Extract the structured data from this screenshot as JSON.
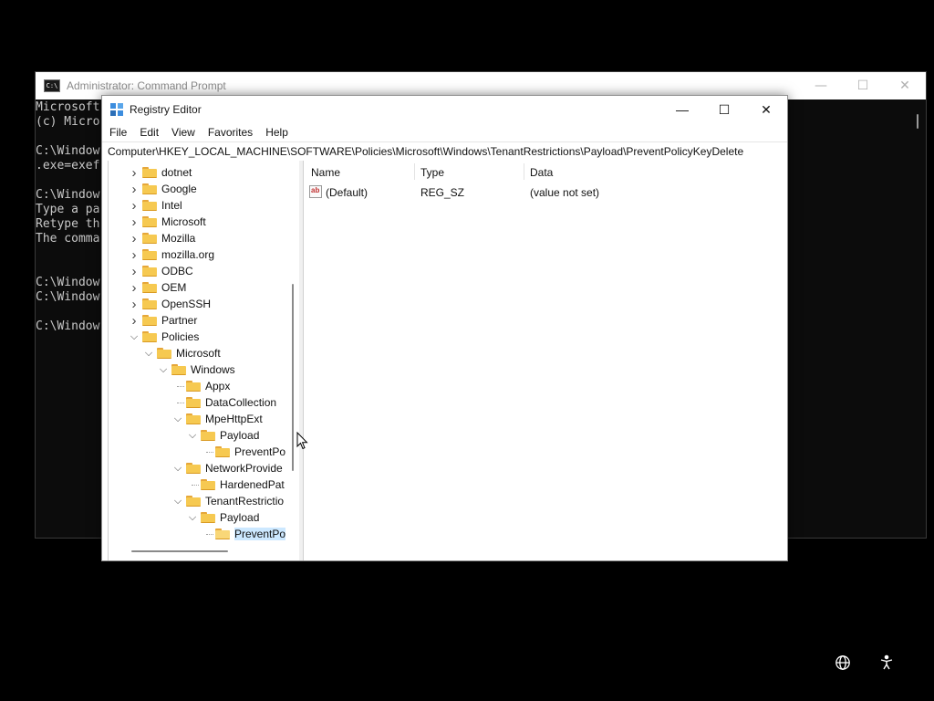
{
  "cmd": {
    "title": "Administrator: Command Prompt",
    "lines": [
      "Microsoft",
      "(c) Micro",
      "",
      "C:\\Window",
      ".exe=exef",
      "",
      "C:\\Window",
      "Type a pa",
      "Retype th",
      "The comma",
      "",
      "",
      "C:\\Window",
      "C:\\Window",
      "",
      "C:\\Window"
    ]
  },
  "regedit": {
    "title": "Registry Editor",
    "menu": [
      "File",
      "Edit",
      "View",
      "Favorites",
      "Help"
    ],
    "address": "Computer\\HKEY_LOCAL_MACHINE\\SOFTWARE\\Policies\\Microsoft\\Windows\\TenantRestrictions\\Payload\\PreventPolicyKeyDelete",
    "tree": [
      {
        "label": "dotnet",
        "state": "collapsed"
      },
      {
        "label": "Google",
        "state": "collapsed"
      },
      {
        "label": "Intel",
        "state": "collapsed"
      },
      {
        "label": "Microsoft",
        "state": "collapsed"
      },
      {
        "label": "Mozilla",
        "state": "collapsed"
      },
      {
        "label": "mozilla.org",
        "state": "collapsed"
      },
      {
        "label": "ODBC",
        "state": "collapsed"
      },
      {
        "label": "OEM",
        "state": "collapsed"
      },
      {
        "label": "OpenSSH",
        "state": "collapsed"
      },
      {
        "label": "Partner",
        "state": "collapsed"
      },
      {
        "label": "Policies",
        "state": "expanded"
      },
      {
        "label": "Microsoft",
        "state": "expanded"
      },
      {
        "label": "Windows",
        "state": "expanded"
      },
      {
        "label": "Appx",
        "state": "leaf"
      },
      {
        "label": "DataCollection",
        "state": "leaf"
      },
      {
        "label": "MpeHttpExt",
        "state": "expanded"
      },
      {
        "label": "Payload",
        "state": "expanded"
      },
      {
        "label": "PreventPo",
        "state": "leaf"
      },
      {
        "label": "NetworkProvide",
        "state": "expanded"
      },
      {
        "label": "HardenedPat",
        "state": "leaf"
      },
      {
        "label": "TenantRestrictio",
        "state": "expanded"
      },
      {
        "label": "Payload",
        "state": "expanded"
      },
      {
        "label": "PreventPo",
        "state": "leaf",
        "selected": true
      }
    ],
    "columns": {
      "name": "Name",
      "type": "Type",
      "data": "Data"
    },
    "values": [
      {
        "name": "(Default)",
        "type": "REG_SZ",
        "data": "(value not set)",
        "icon": "ab-string-icon"
      }
    ]
  },
  "taskbar": {
    "icons": [
      "globe-icon",
      "accessibility-icon"
    ]
  }
}
